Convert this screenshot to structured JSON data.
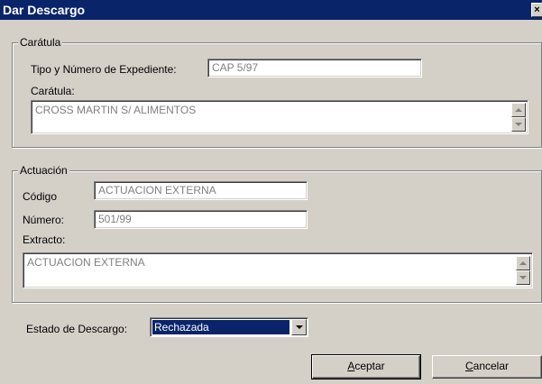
{
  "window": {
    "title": "Dar Descargo",
    "close_glyph": "×"
  },
  "caratula_group": {
    "legend": "Carátula",
    "tipo_label": "Tipo y Número de Expediente:",
    "tipo_value": "CAP 5/97",
    "caratula_label": "Carátula:",
    "caratula_value": "CROSS MARTIN S/ ALIMENTOS"
  },
  "actuacion_group": {
    "legend": "Actuación",
    "codigo_label": "Código",
    "codigo_value": "ACTUACION EXTERNA",
    "numero_label": "Número:",
    "numero_value": "501/99",
    "extracto_label": "Extracto:",
    "extracto_value": "ACTUACION EXTERNA"
  },
  "estado": {
    "label": "Estado de Descargo:",
    "selected": "Rechazada"
  },
  "buttons": {
    "aceptar_first": "A",
    "aceptar_rest": "ceptar",
    "cancelar_first": "C",
    "cancelar_rest": "ancelar"
  },
  "icons": {
    "scroll_up": "arrow-up-icon",
    "scroll_down": "arrow-down-icon",
    "dropdown": "chevron-down-icon",
    "close": "close-icon"
  },
  "colors": {
    "titlebar": "#0a246a",
    "face": "#d4d0c8",
    "disabled_text": "#808080",
    "selection": "#0a246a"
  }
}
